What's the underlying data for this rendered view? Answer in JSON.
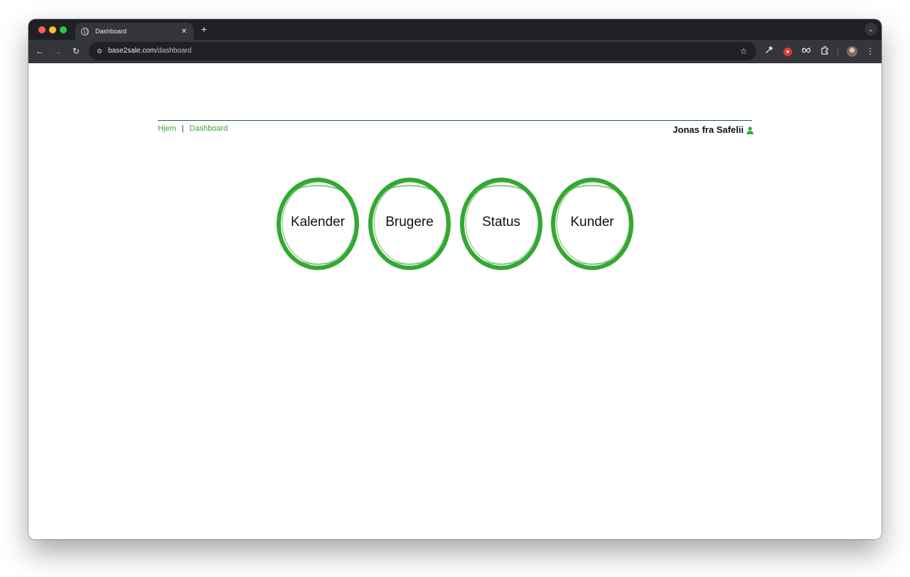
{
  "browser": {
    "tab_title": "Dashboard",
    "url_host": "base2sale.com",
    "url_path": "/dashboard"
  },
  "icons": {
    "tab_favicon": "globe-icon",
    "tab_close": "close-icon",
    "new_tab": "plus-icon",
    "tab_search": "chevron-down-icon",
    "back": "arrow-left-icon",
    "forward": "arrow-right-icon",
    "reload": "reload-icon",
    "site_info": "tune-icon",
    "bookmark": "star-icon",
    "eyedropper": "eyedropper-icon",
    "ext_red": "red-shield-icon",
    "ext_glasses": "glasses-icon",
    "extensions": "puzzle-icon",
    "profile": "avatar-icon",
    "menu": "kebab-menu-icon",
    "user": "user-icon"
  },
  "breadcrumb": {
    "home": "Hjem",
    "separator": "|",
    "current": "Dashboard"
  },
  "user": {
    "name": "Jonas fra Safelii"
  },
  "dashboard": {
    "items": [
      {
        "label": "Kalender"
      },
      {
        "label": "Brugere"
      },
      {
        "label": "Status"
      },
      {
        "label": "Kunder"
      }
    ]
  },
  "colors": {
    "accent_green": "#2eaa2e",
    "rule_green": "#1e5e3e",
    "chrome_dark": "#202124",
    "chrome_toolbar": "#35363a"
  }
}
